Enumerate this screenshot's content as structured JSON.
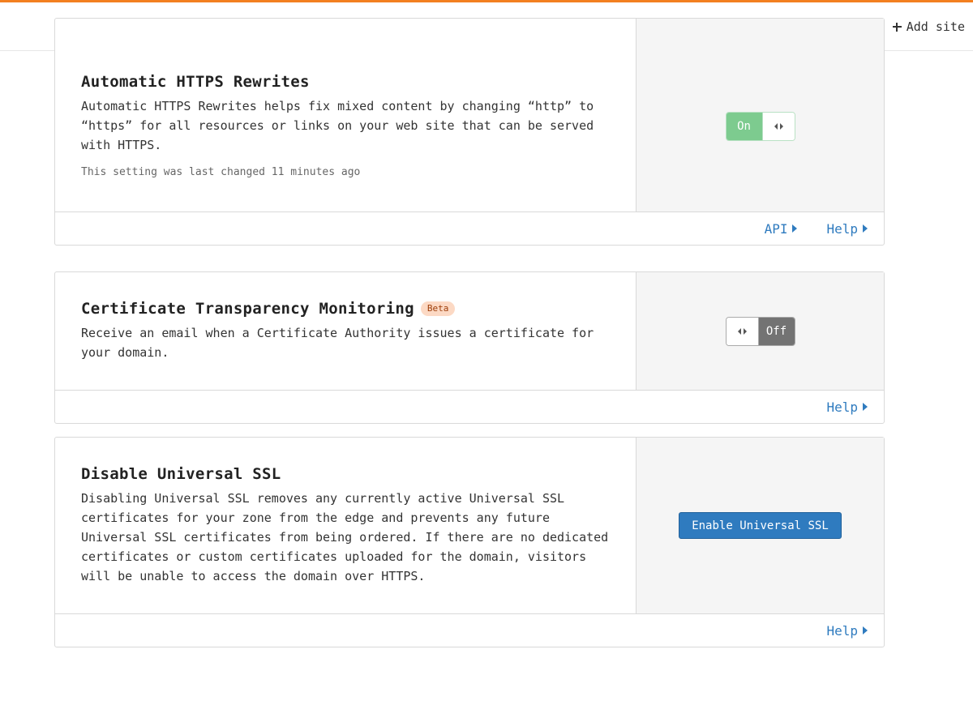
{
  "colors": {
    "accent": "#f38020",
    "link": "#2f7bbf",
    "toggle_on": "#7dcb8f",
    "toggle_off": "#737373",
    "badge_bg": "#fcd9c4"
  },
  "header": {
    "add_site_label": "Add site",
    "add_site_icon": "plus-icon"
  },
  "cards": [
    {
      "title": "Automatic HTTPS Rewrites",
      "description": "Automatic HTTPS Rewrites helps fix mixed content by changing “http” to “https” for all resources or links on your web site that can be served with HTTPS.",
      "meta": "This setting was last changed 11 minutes ago",
      "control": {
        "type": "toggle",
        "state": "on",
        "label": "On"
      },
      "footer_links": [
        "API",
        "Help"
      ]
    },
    {
      "title": "Certificate Transparency Monitoring",
      "badge": "Beta",
      "description": "Receive an email when a Certificate Authority issues a certificate for your domain.",
      "control": {
        "type": "toggle",
        "state": "off",
        "label": "Off"
      },
      "footer_links": [
        "Help"
      ]
    },
    {
      "title": "Disable Universal SSL",
      "description": "Disabling Universal SSL removes any currently active Universal SSL certificates for your zone from the edge and prevents any future Universal SSL certificates from being ordered. If there are no dedicated certificates or custom certificates uploaded for the domain, visitors will be unable to access the domain over HTTPS.",
      "control": {
        "type": "button",
        "label": "Enable Universal SSL"
      },
      "footer_links": [
        "Help"
      ]
    }
  ]
}
